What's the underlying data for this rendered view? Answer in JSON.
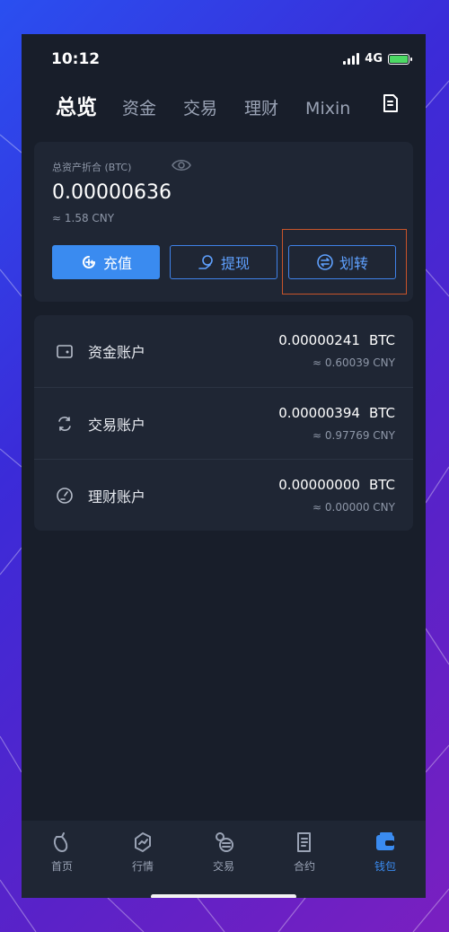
{
  "status_bar": {
    "time": "10:12",
    "network": "4G"
  },
  "header": {
    "tabs": [
      {
        "label": "总览",
        "active": true
      },
      {
        "label": "资金",
        "active": false
      },
      {
        "label": "交易",
        "active": false
      },
      {
        "label": "理财",
        "active": false
      },
      {
        "label": "Mixin",
        "active": false
      }
    ],
    "right_icon": "bill-icon"
  },
  "total": {
    "label": "总资产折合 (BTC)",
    "value": "0.00000636",
    "cny": "≈ 1.58 CNY",
    "eye_icon": "eye-icon"
  },
  "actions": {
    "deposit": "充值",
    "withdraw": "提现",
    "transfer": "划转"
  },
  "accounts": [
    {
      "name": "资金账户",
      "amount": "0.00000241",
      "currency": "BTC",
      "cny": "≈ 0.60039 CNY",
      "icon": "wallet-icon"
    },
    {
      "name": "交易账户",
      "amount": "0.00000394",
      "currency": "BTC",
      "cny": "≈ 0.97769 CNY",
      "icon": "exchange-icon"
    },
    {
      "name": "理财账户",
      "amount": "0.00000000",
      "currency": "BTC",
      "cny": "≈ 0.00000 CNY",
      "icon": "gauge-icon"
    }
  ],
  "bottom_nav": [
    {
      "label": "首页",
      "active": false
    },
    {
      "label": "行情",
      "active": false
    },
    {
      "label": "交易",
      "active": false
    },
    {
      "label": "合约",
      "active": false
    },
    {
      "label": "钱包",
      "active": true
    }
  ],
  "colors": {
    "accent": "#3a8bf0",
    "background": "#181e2a",
    "card": "#1f2634",
    "highlight": "#c8542a"
  }
}
